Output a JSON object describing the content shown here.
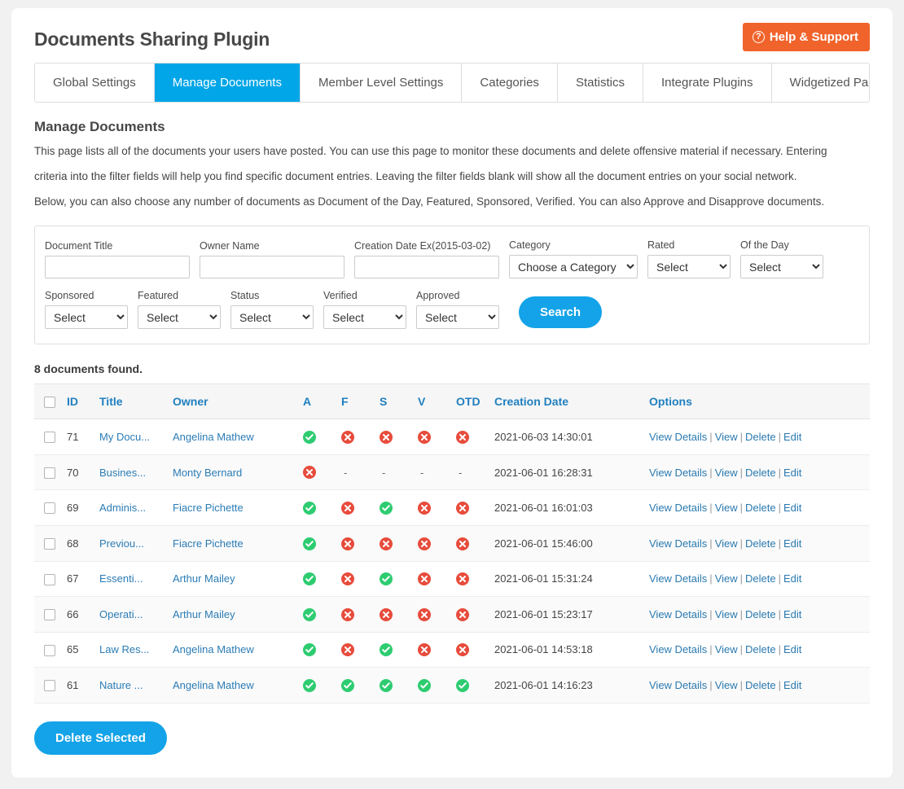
{
  "header": {
    "title": "Documents Sharing Plugin",
    "help_button": "Help & Support",
    "help_icon": "question-circle-icon"
  },
  "tabs": [
    {
      "label": "Global Settings",
      "active": false
    },
    {
      "label": "Manage Documents",
      "active": true
    },
    {
      "label": "Member Level Settings",
      "active": false
    },
    {
      "label": "Categories",
      "active": false
    },
    {
      "label": "Statistics",
      "active": false
    },
    {
      "label": "Integrate Plugins",
      "active": false
    },
    {
      "label": "Widgetized Pages",
      "active": false
    }
  ],
  "intro": {
    "title": "Manage Documents",
    "line1": "This page lists all of the documents your users have posted. You can use this page to monitor these documents and delete offensive material if necessary. Entering",
    "line2": "criteria into the filter fields will help you find specific document entries. Leaving the filter fields blank will show all the document entries on your social network.",
    "line3": "Below, you can also choose any number of documents as Document of the Day, Featured, Sponsored, Verified. You can also Approve and Disapprove documents."
  },
  "filters": {
    "document_title": {
      "label": "Document Title",
      "value": "",
      "placeholder": ""
    },
    "owner_name": {
      "label": "Owner Name",
      "value": "",
      "placeholder": ""
    },
    "creation_date": {
      "label": "Creation Date Ex(2015-03-02)",
      "value": "",
      "placeholder": ""
    },
    "category": {
      "label": "Category",
      "value": "Choose a Category"
    },
    "rated": {
      "label": "Rated",
      "value": "Select"
    },
    "of_the_day": {
      "label": "Of the Day",
      "value": "Select"
    },
    "sponsored": {
      "label": "Sponsored",
      "value": "Select"
    },
    "featured": {
      "label": "Featured",
      "value": "Select"
    },
    "status": {
      "label": "Status",
      "value": "Select"
    },
    "verified": {
      "label": "Verified",
      "value": "Select"
    },
    "approved": {
      "label": "Approved",
      "value": "Select"
    },
    "search_button": "Search"
  },
  "results": {
    "count_text": "8 documents found.",
    "columns": [
      "ID",
      "Title",
      "Owner",
      "A",
      "F",
      "S",
      "V",
      "OTD",
      "Creation Date",
      "Options"
    ],
    "options_labels": {
      "view_details": "View Details",
      "view": "View",
      "delete": "Delete",
      "edit": "Edit"
    },
    "rows": [
      {
        "id": "71",
        "title": "My Docu...",
        "owner": "Angelina Mathew",
        "a": "yes",
        "f": "no",
        "s": "no",
        "v": "no",
        "otd": "no",
        "date": "2021-06-03 14:30:01"
      },
      {
        "id": "70",
        "title": "Busines...",
        "owner": "Monty Bernard",
        "a": "no",
        "f": "-",
        "s": "-",
        "v": "-",
        "otd": "-",
        "date": "2021-06-01 16:28:31"
      },
      {
        "id": "69",
        "title": "Adminis...",
        "owner": "Fiacre Pichette",
        "a": "yes",
        "f": "no",
        "s": "yes",
        "v": "no",
        "otd": "no",
        "date": "2021-06-01 16:01:03"
      },
      {
        "id": "68",
        "title": "Previou...",
        "owner": "Fiacre Pichette",
        "a": "yes",
        "f": "no",
        "s": "no",
        "v": "no",
        "otd": "no",
        "date": "2021-06-01 15:46:00"
      },
      {
        "id": "67",
        "title": "Essenti...",
        "owner": "Arthur Mailey",
        "a": "yes",
        "f": "no",
        "s": "yes",
        "v": "no",
        "otd": "no",
        "date": "2021-06-01 15:31:24"
      },
      {
        "id": "66",
        "title": "Operati...",
        "owner": "Arthur Mailey",
        "a": "yes",
        "f": "no",
        "s": "no",
        "v": "no",
        "otd": "no",
        "date": "2021-06-01 15:23:17"
      },
      {
        "id": "65",
        "title": "Law Res...",
        "owner": "Angelina Mathew",
        "a": "yes",
        "f": "no",
        "s": "yes",
        "v": "no",
        "otd": "no",
        "date": "2021-06-01 14:53:18"
      },
      {
        "id": "61",
        "title": "Nature ...",
        "owner": "Angelina Mathew",
        "a": "yes",
        "f": "yes",
        "s": "yes",
        "v": "yes",
        "otd": "yes",
        "date": "2021-06-01 14:16:23"
      }
    ]
  },
  "footer": {
    "delete_selected": "Delete Selected"
  },
  "colors": {
    "accent_blue": "#00a6e8",
    "button_blue": "#14a3e8",
    "help_orange": "#f0632b",
    "link_blue": "#2a7ab0",
    "yes_green": "#2ecc71",
    "no_red": "#e74c3c"
  }
}
